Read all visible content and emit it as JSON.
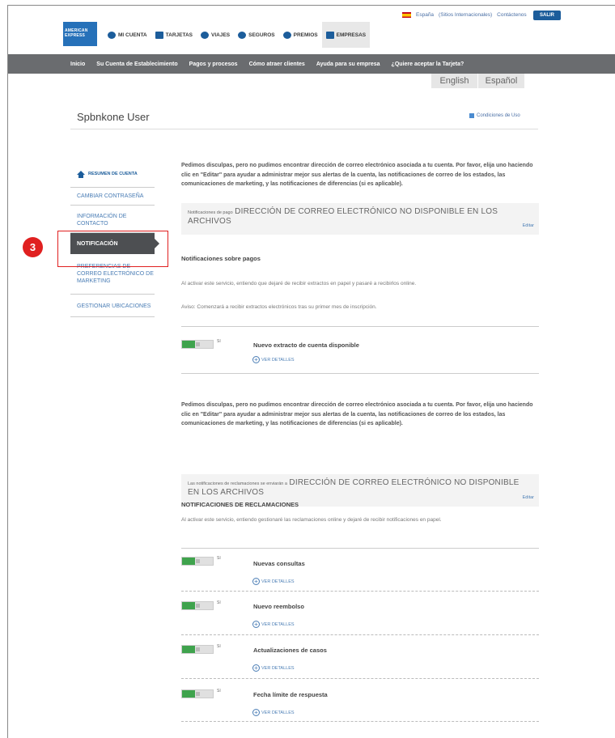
{
  "header": {
    "country": "España",
    "intl_sites": "(Sitios Internacionales)",
    "contact": "Contáctenos",
    "logout": "SALIR",
    "logo_text": "AMERICAN EXPRESS",
    "nav": [
      {
        "label": "MI CUENTA",
        "icon": "person-icon"
      },
      {
        "label": "TARJETAS",
        "icon": "card-icon"
      },
      {
        "label": "VIAJES",
        "icon": "plane-icon"
      },
      {
        "label": "SEGUROS",
        "icon": "shield-icon"
      },
      {
        "label": "PREMIOS",
        "icon": "gift-icon"
      },
      {
        "label": "EMPRESAS",
        "icon": "briefcase-icon",
        "active": true
      }
    ],
    "subnav": [
      "Inicio",
      "Su Cuenta de Establecimiento",
      "Pagos y procesos",
      "Cómo atraer clientes",
      "Ayuda para su empresa",
      "¿Quiere aceptar la Tarjeta?"
    ],
    "languages": [
      "English",
      "Español"
    ]
  },
  "user": {
    "name": "Spbnkone User",
    "terms": "Condiciones de Uso"
  },
  "sidebar": {
    "items": [
      {
        "label": "RESUMEN DE CUENTA"
      },
      {
        "label": "CAMBIAR CONTRASEÑA"
      },
      {
        "label": "INFORMACIÓN DE CONTACTO"
      },
      {
        "label": "NOTIFICACIÓN",
        "active": true
      },
      {
        "label": "PREFERENCIAS DE CORREO ELECTRÓNICO DE MARKETING"
      },
      {
        "label": "GESTIONAR UBICACIONES"
      }
    ],
    "callout_number": "3"
  },
  "payments": {
    "apology": "Pedimos disculpas, pero no pudimos encontrar dirección de correo electrónico asociada a tu cuenta. Por favor, elija uno haciendo clic en \"Editar\" para ayudar a administrar mejor sus alertas de la cuenta, las notificaciones de correo de los estados, las comunicaciones de marketing, y las notificaciones de diferencias (si es aplicable).",
    "email_prefix": "Notificaciones de pago",
    "email_status": "DIRECCIÓN DE CORREO ELECTRÓNICO NO DISPONIBLE EN LOS ARCHIVOS",
    "edit": "Editar",
    "heading": "Notificaciones sobre pagos",
    "text1": "Al activar este servicio, entiendo que dejaré de recibir extractos en papel y pasaré a recibirlos online.",
    "text2": "Aviso: Comenzará a recibir extractos electrónicos tras su primer mes de inscripción.",
    "toggle_label": "Sí",
    "row_title": "Nuevo extracto de cuenta disponible",
    "details": "VER DETALLES"
  },
  "claims": {
    "apology": "Pedimos disculpas, pero no pudimos encontrar dirección de correo electrónico asociada a tu cuenta. Por favor, elija uno haciendo clic en \"Editar\" para ayudar a administrar mejor sus alertas de la cuenta, las notificaciones de correo de los estados, las comunicaciones de marketing, y las notificaciones de diferencias (si es aplicable).",
    "email_prefix": "Las notificaciones de reclamaciones se enviarán a",
    "email_status": "DIRECCIÓN DE CORREO ELECTRÓNICO NO DISPONIBLE EN LOS ARCHIVOS",
    "edit": "Editar",
    "heading": "NOTIFICACIONES DE RECLAMACIONES",
    "text": "Al activar este servicio, entiendo gestionaré las reclamaciones online y dejaré de recibir notificaciones en papel.",
    "toggle_label": "Sí",
    "details": "VER DETALLES",
    "rows": [
      {
        "title": "Nuevas consultas"
      },
      {
        "title": "Nuevo reembolso"
      },
      {
        "title": "Actualizaciones de casos"
      },
      {
        "title": "Fecha límite de respuesta"
      }
    ]
  }
}
